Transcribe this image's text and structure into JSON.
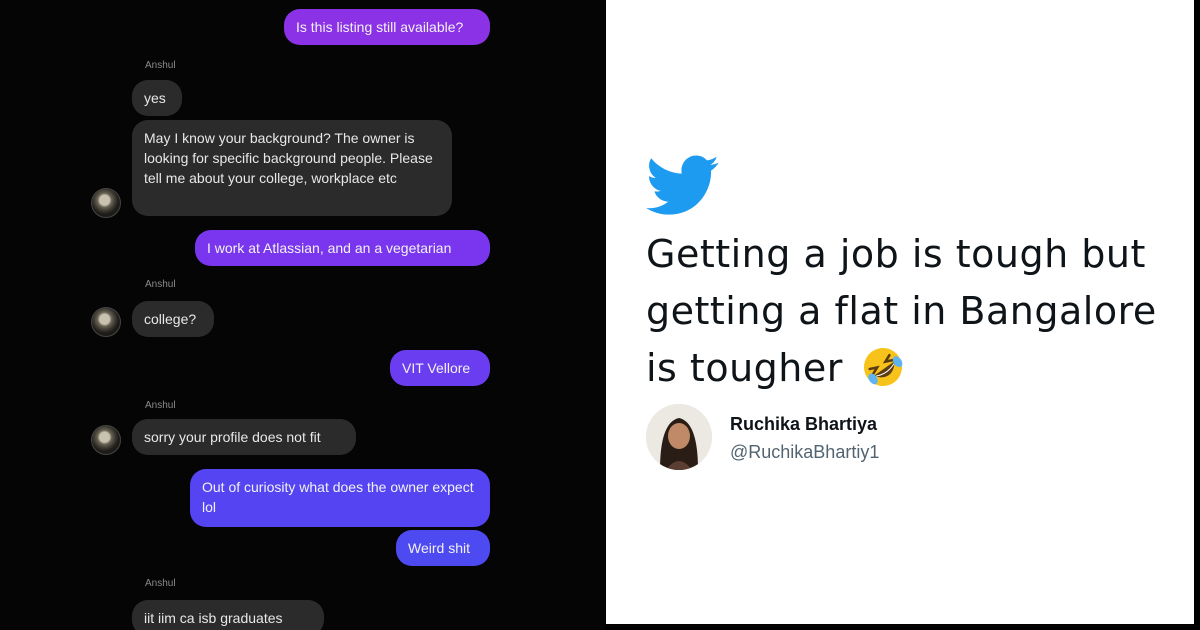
{
  "chat": {
    "contact_name": "Anshul",
    "messages": [
      {
        "from": "me",
        "text": "Is this listing still available?"
      },
      {
        "from": "them",
        "text": "yes"
      },
      {
        "from": "them",
        "text": "May I know your background? The owner is looking for specific background people. Please tell me about your college, workplace etc"
      },
      {
        "from": "me",
        "text": "I work at Atlassian, and an a vegetarian"
      },
      {
        "from": "them",
        "text": "college?"
      },
      {
        "from": "me",
        "text": "VIT Vellore"
      },
      {
        "from": "them",
        "text": "sorry your profile does not fit"
      },
      {
        "from": "me",
        "text": "Out of curiosity what does the owner expect lol"
      },
      {
        "from": "me",
        "text": "Weird shit"
      },
      {
        "from": "them",
        "text": "iit iim ca isb graduates"
      }
    ],
    "colors": {
      "outgoing_top": "#8a2be2",
      "outgoing_bottom": "#4b4df0",
      "incoming": "#2b2b2b"
    }
  },
  "tweet": {
    "platform_icon": "twitter-bird-icon",
    "text": "Getting a job is tough but getting a flat in Bangalore is tougher",
    "emoji": "rolling-on-floor-laughing-emoji",
    "author": {
      "name": "Ruchika Bhartiya",
      "handle": "@RuchikaBhartiy1"
    },
    "colors": {
      "brand": "#1d9bf0",
      "text": "#0f1419",
      "handle": "#536471"
    }
  }
}
